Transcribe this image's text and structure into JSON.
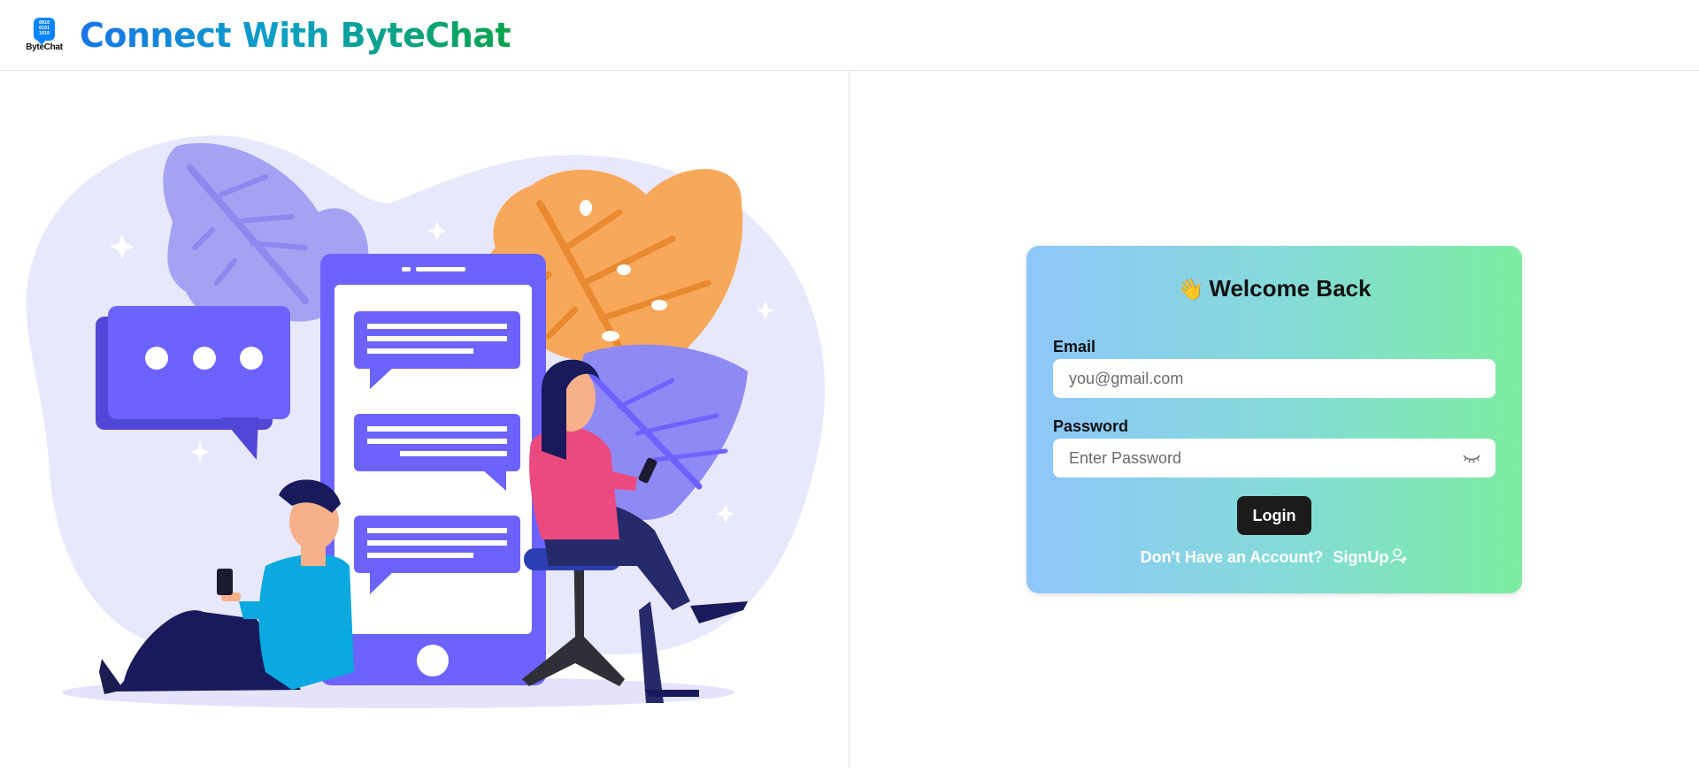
{
  "header": {
    "logo_text": "ByteChat",
    "logo_bits": "0010\n0101\n1010",
    "title": "Connect With ByteChat"
  },
  "login_card": {
    "wave_emoji": "👋",
    "title": "Welcome Back",
    "email_label": "Email",
    "email_placeholder": "you@gmail.com",
    "email_value": "",
    "password_label": "Password",
    "password_placeholder": "Enter Password",
    "password_value": "",
    "login_button": "Login",
    "signup_prompt": "Don't Have an Account?",
    "signup_link": "SignUp"
  },
  "icons": {
    "password_toggle": "eye-closed-icon",
    "signup": "user-plus-icon"
  },
  "colors": {
    "card_gradient_start": "#8ec6fb",
    "card_gradient_end": "#7ceda0",
    "login_button_bg": "#1b1b1b",
    "illustration_primary": "#6c63ff",
    "illustration_accent": "#f7a34e"
  }
}
